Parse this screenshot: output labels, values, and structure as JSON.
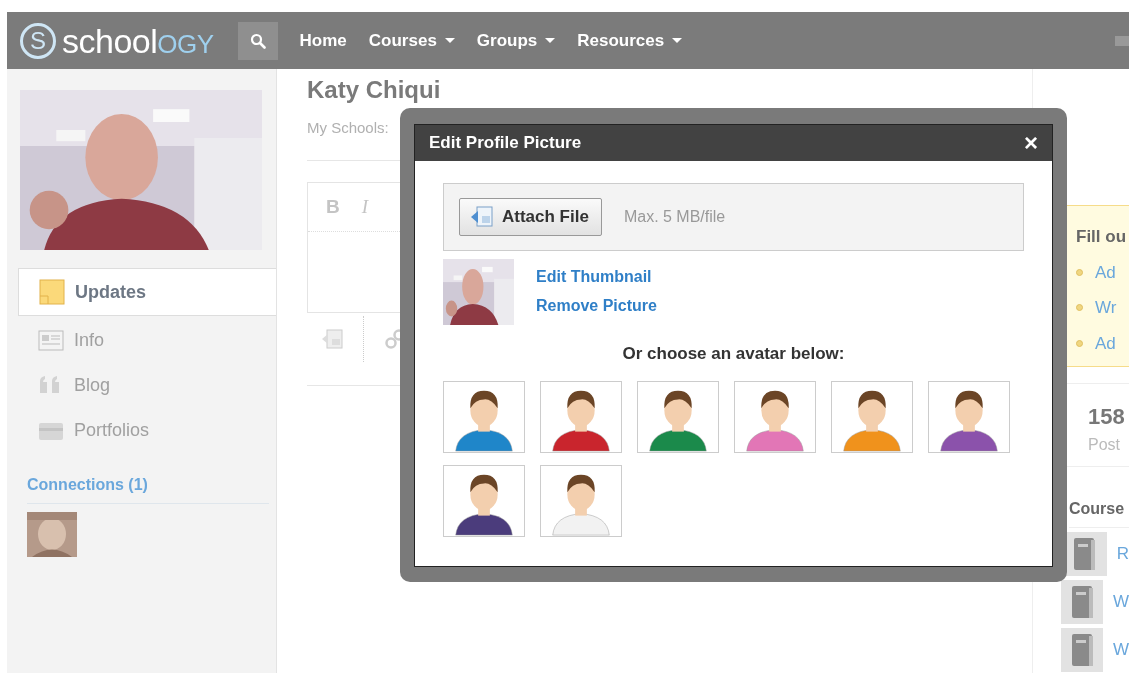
{
  "navbar": {
    "logo": {
      "mark": "S",
      "word": "school",
      "accent": "OGY"
    },
    "items": [
      {
        "label": "Home",
        "dropdown": false
      },
      {
        "label": "Courses",
        "dropdown": true
      },
      {
        "label": "Groups",
        "dropdown": true
      },
      {
        "label": "Resources",
        "dropdown": true
      }
    ]
  },
  "sidebar": {
    "nav": [
      {
        "label": "Updates",
        "kind": "updates",
        "selected": true
      },
      {
        "label": "Info",
        "kind": "info",
        "selected": false
      },
      {
        "label": "Blog",
        "kind": "blog",
        "selected": false
      },
      {
        "label": "Portfolios",
        "kind": "portfolios",
        "selected": false
      }
    ],
    "connections_title": "Connections (1)"
  },
  "profile": {
    "name": "Katy Chiqui",
    "schools": "My Schools:"
  },
  "editor": {
    "buttons": [
      "B",
      "I"
    ]
  },
  "modal": {
    "title": "Edit Profile Picture",
    "close": "×",
    "attach_button": "Attach File",
    "max_size": "Max. 5 MB/file",
    "links": [
      "Edit Thumbnail",
      "Remove Picture"
    ],
    "avatar_prompt": "Or choose an avatar below:",
    "avatars": [
      {
        "color": "#1f86c9"
      },
      {
        "color": "#c9252d"
      },
      {
        "color": "#1b8a4b"
      },
      {
        "color": "#e276b6"
      },
      {
        "color": "#f0921c"
      },
      {
        "color": "#8b52ab"
      },
      {
        "color": "#4b3c7c"
      },
      {
        "color": "#f2f2f2"
      }
    ]
  },
  "right": {
    "prompt_title": "Fill ou",
    "prompt_items": [
      "Ad",
      "Wr",
      "Ad"
    ],
    "stat_value": "158",
    "stat_label": "Post",
    "courses_title": "Course",
    "courses": [
      "R",
      "W",
      "W"
    ]
  }
}
